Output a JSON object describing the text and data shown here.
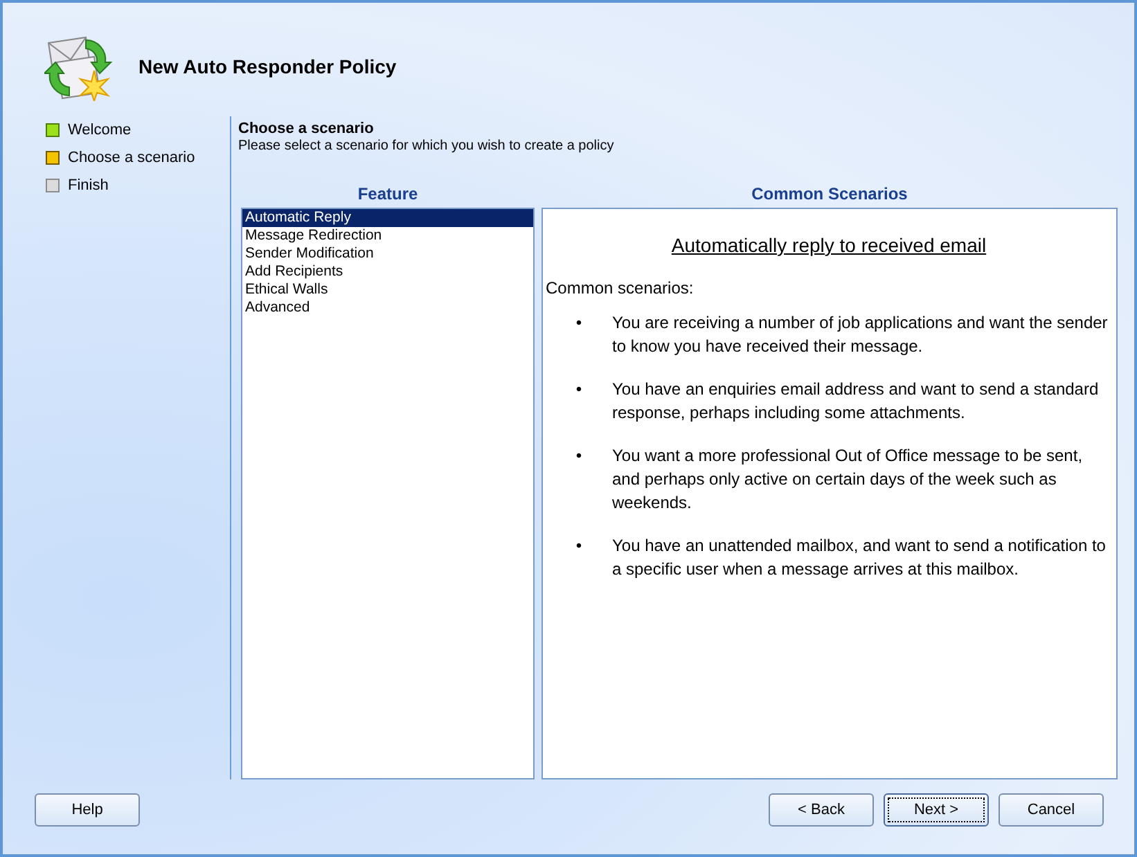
{
  "window": {
    "title": "New Auto Responder Policy"
  },
  "steps": [
    {
      "label": "Welcome",
      "done": true,
      "current": false
    },
    {
      "label": "Choose a scenario",
      "done": false,
      "current": true
    },
    {
      "label": "Finish",
      "done": false,
      "current": false
    }
  ],
  "page": {
    "heading": "Choose a scenario",
    "subtitle": "Please select a scenario for which you wish to create a policy"
  },
  "feature": {
    "title": "Feature",
    "items": [
      {
        "label": "Automatic Reply",
        "selected": true
      },
      {
        "label": "Message Redirection",
        "selected": false
      },
      {
        "label": "Sender Modification",
        "selected": false
      },
      {
        "label": "Add Recipients",
        "selected": false
      },
      {
        "label": "Ethical Walls",
        "selected": false
      },
      {
        "label": "Advanced",
        "selected": false
      }
    ]
  },
  "scenarios": {
    "title": "Common Scenarios",
    "heading": "Automatically reply to received email",
    "intro": "Common scenarios:",
    "bullet": "•",
    "items": [
      "You are receiving a number of job applications and want the sender to know you have received their message.",
      "You have an enquiries email address and want to send a standard response, perhaps including some attachments.",
      "You want a more professional Out of Office message to be sent, and perhaps only active on certain days of the week such as weekends.",
      "You have an unattended mailbox, and want to send a notification to a specific user when a message arrives at this mailbox."
    ]
  },
  "help_button": "Help",
  "nav_buttons": [
    {
      "label": "< Back",
      "default": false
    },
    {
      "label": "Next >",
      "default": true
    },
    {
      "label": "Cancel",
      "default": false
    }
  ]
}
